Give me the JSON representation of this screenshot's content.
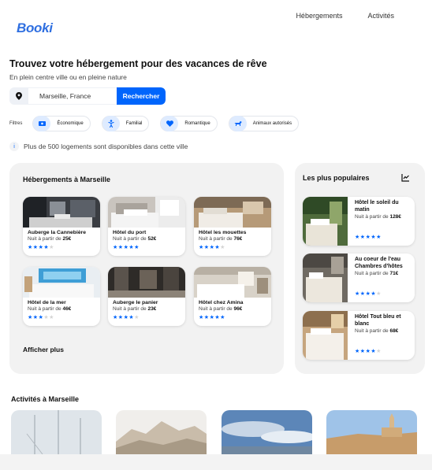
{
  "brand": {
    "logo": "Booki"
  },
  "nav": {
    "items": [
      "Hébergements",
      "Activités"
    ]
  },
  "hero": {
    "title": "Trouvez votre hébergement pour des vacances de rêve",
    "subtitle": "En plein centre ville ou en pleine nature"
  },
  "search": {
    "value": "Marseille, France",
    "button": "Rechercher",
    "icon": "location-pin-icon"
  },
  "filters": {
    "label": "Filtres",
    "items": [
      {
        "label": "Économique",
        "icon": "money-icon"
      },
      {
        "label": "Familial",
        "icon": "child-icon"
      },
      {
        "label": "Romantique",
        "icon": "heart-icon"
      },
      {
        "label": "Animaux autorisés",
        "icon": "dog-icon"
      }
    ]
  },
  "info": {
    "icon": "info-icon",
    "text": "Plus de 500 logements sont disponibles dans cette ville"
  },
  "lodgings": {
    "title": "Hébergements à Marseille",
    "price_prefix": "Nuit à partir de",
    "items": [
      {
        "name": "Auberge la Cannebière",
        "price": "25€",
        "rating": 4
      },
      {
        "name": "Hôtel du port",
        "price": "52€",
        "rating": 5
      },
      {
        "name": "Hôtel les mouettes",
        "price": "76€",
        "rating": 4
      },
      {
        "name": "Hôtel de la mer",
        "price": "46€",
        "rating": 3
      },
      {
        "name": "Auberge le panier",
        "price": "23€",
        "rating": 4
      },
      {
        "name": "Hôtel chez Amina",
        "price": "96€",
        "rating": 5
      }
    ],
    "show_more": "Afficher plus"
  },
  "popular": {
    "title": "Les plus populaires",
    "icon": "trending-chart-icon",
    "price_prefix": "Nuit à partir de",
    "items": [
      {
        "name": "Hôtel le soleil du matin",
        "price": "128€",
        "rating": 5
      },
      {
        "name": "Au coeur de l'eau Chambres d'hôtes",
        "price": "71€",
        "rating": 4
      },
      {
        "name": "Hôtel Tout bleu et blanc",
        "price": "68€",
        "rating": 4
      }
    ]
  },
  "activities": {
    "title": "Activités à Marseille"
  },
  "colors": {
    "accent": "#0065fc",
    "accent_light": "#deebff",
    "panel": "#f2f2f2",
    "logo": "#2f6fe0"
  }
}
